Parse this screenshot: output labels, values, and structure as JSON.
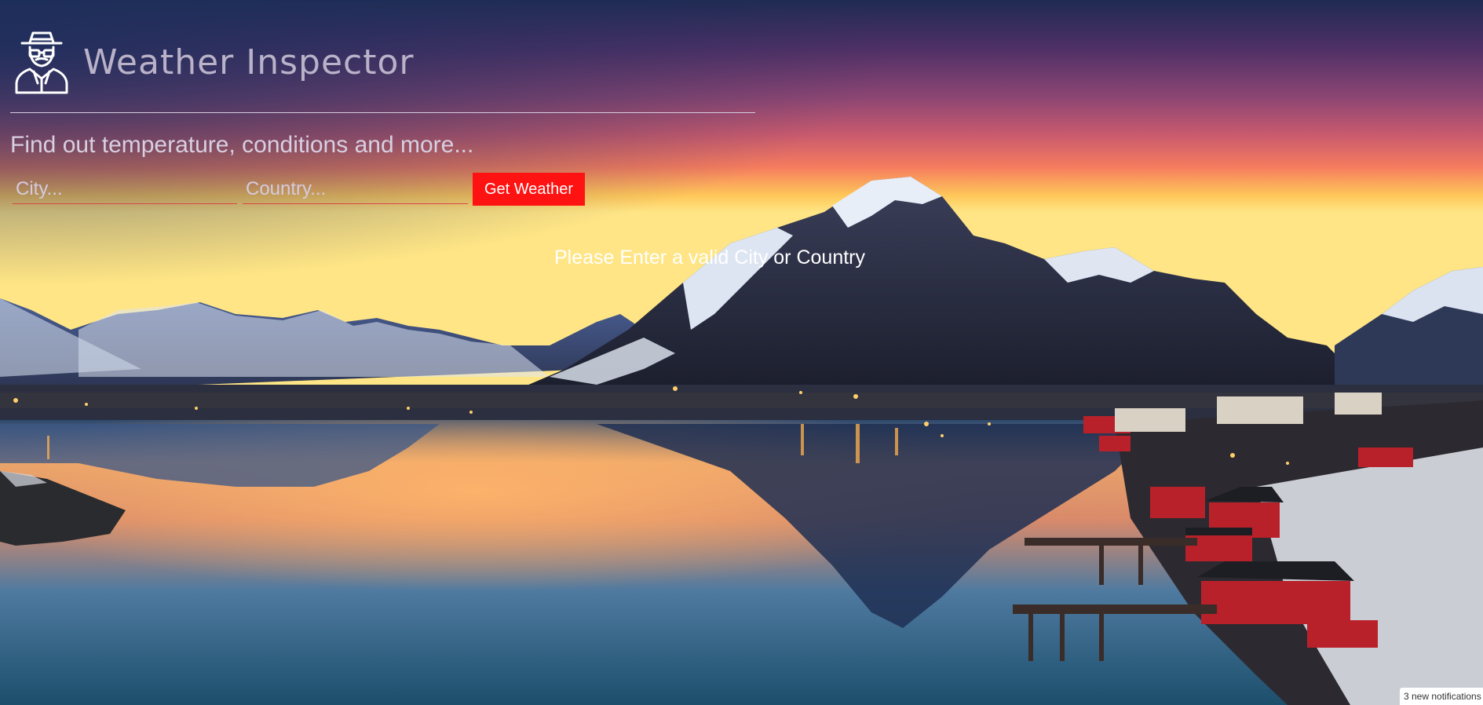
{
  "app": {
    "title": "Weather Inspector",
    "subtitle": "Find out temperature, conditions and more..."
  },
  "form": {
    "city_placeholder": "City...",
    "country_placeholder": "Country...",
    "submit_label": "Get Weather"
  },
  "status": {
    "message": "Please Enter a valid City or Country"
  },
  "notification": {
    "text": "3 new notifications"
  },
  "icons": {
    "logo": "detective-icon"
  },
  "colors": {
    "accent": "#ff1212",
    "title_text": "#b9b2c8",
    "input_underline": "#d9464a"
  }
}
